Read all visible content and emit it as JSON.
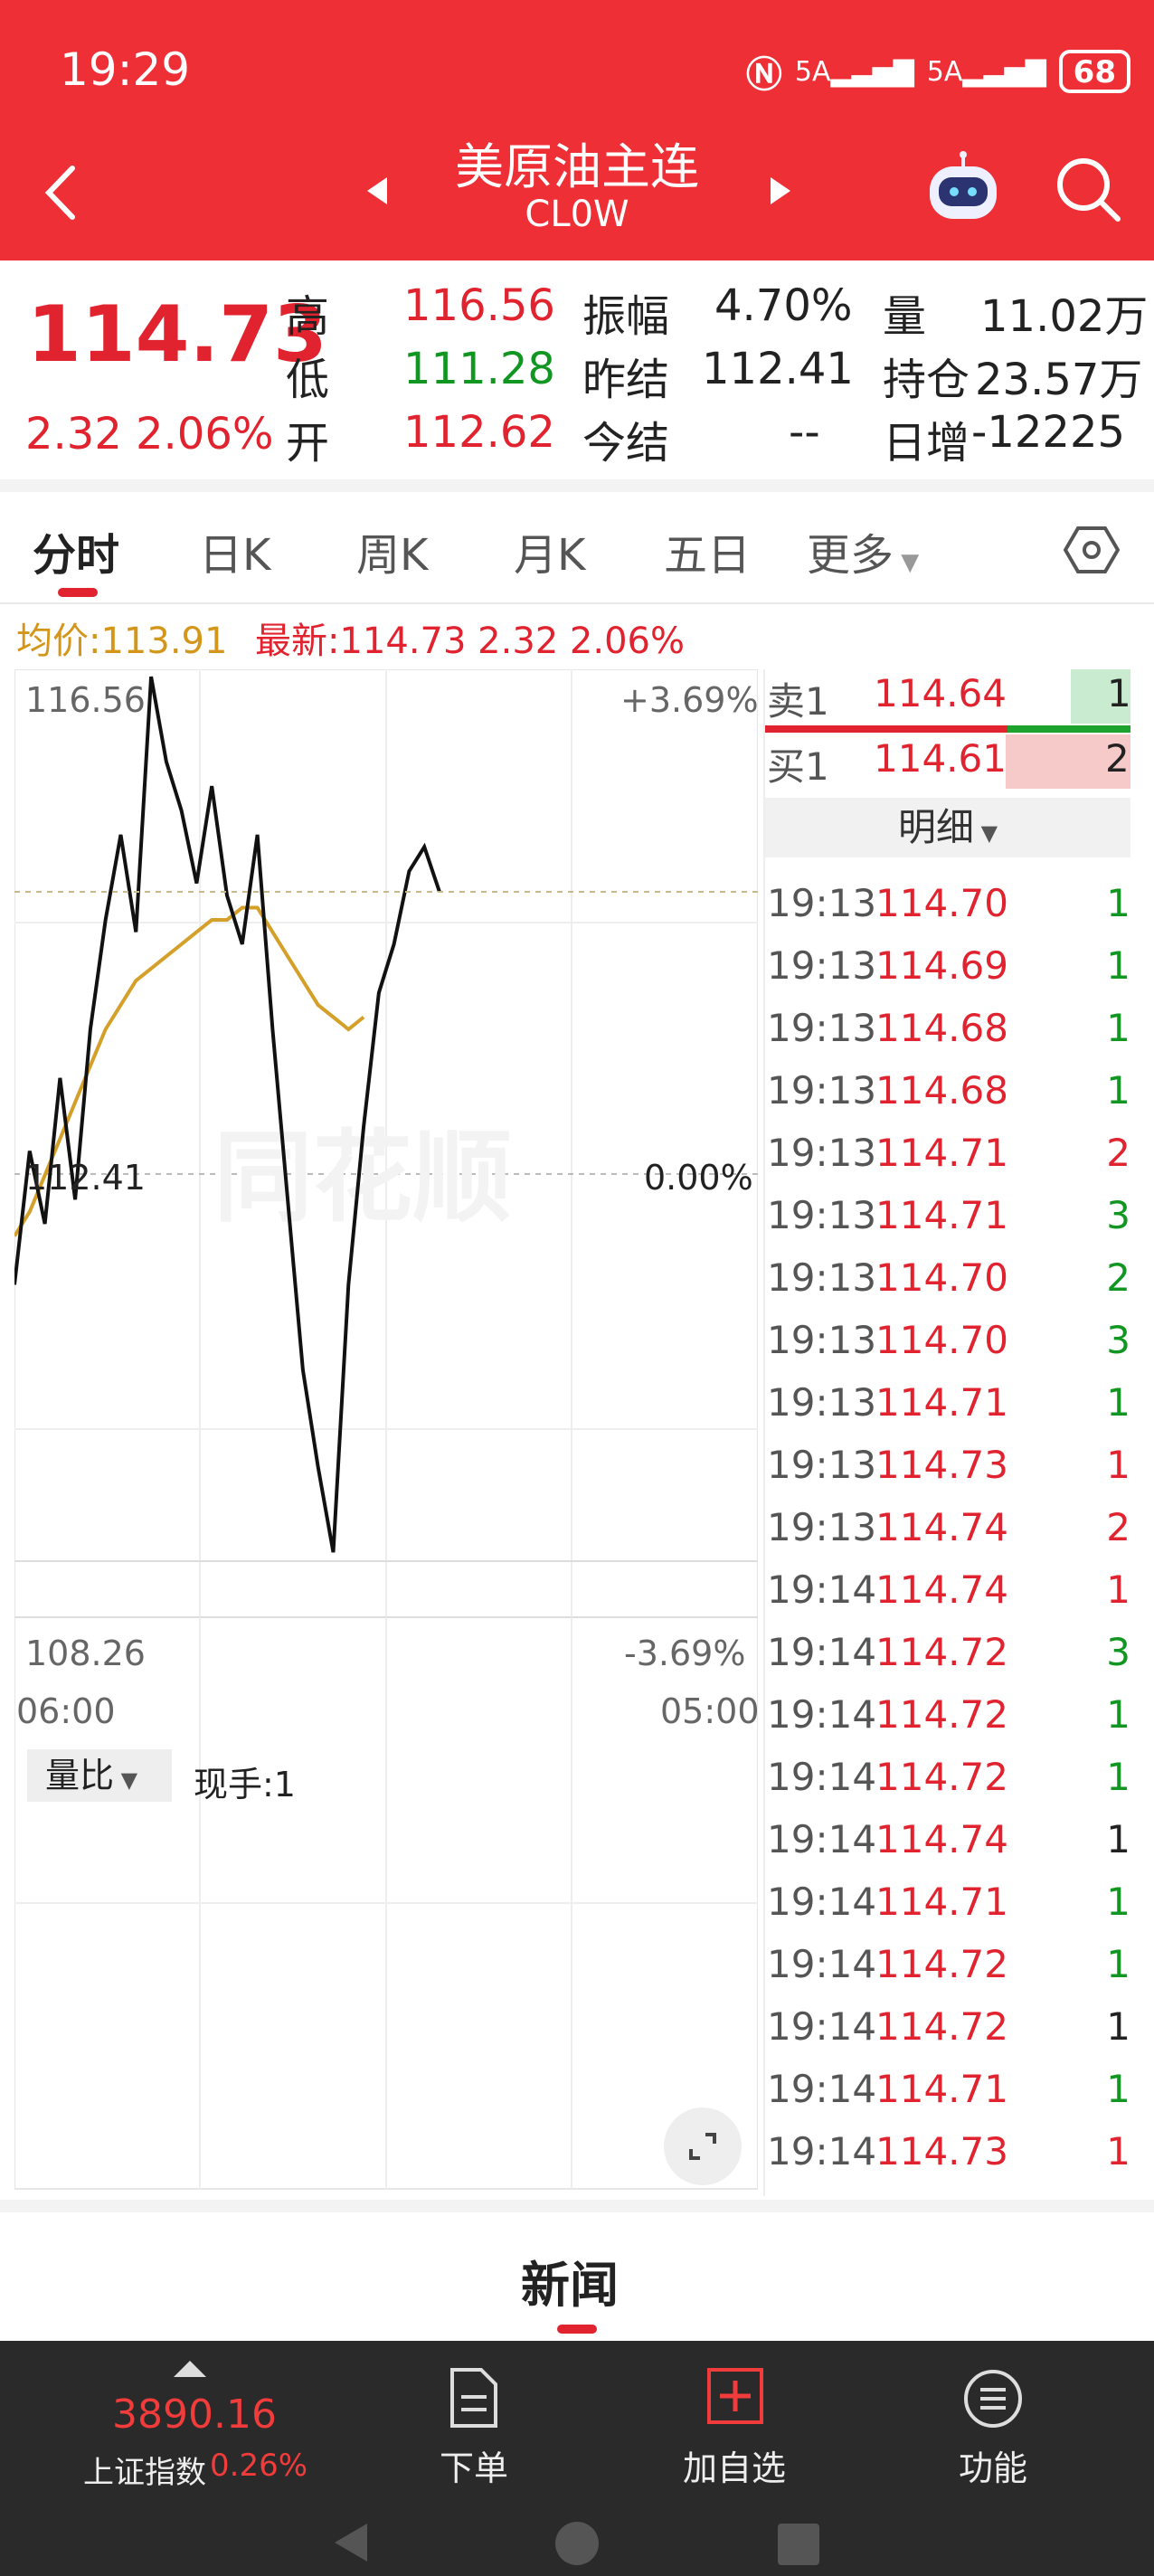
{
  "status": {
    "time": "19:29",
    "signal1": "5A",
    "signal2": "5A",
    "battery": "68"
  },
  "header": {
    "title": "美原油主连",
    "code": "CL0W"
  },
  "quote": {
    "price": "114.73",
    "change": "2.32",
    "change_pct": "2.06%",
    "high_label": "高",
    "high": "116.56",
    "low_label": "低",
    "low": "111.28",
    "open_label": "开",
    "open": "112.62",
    "amp_label": "振幅",
    "amp": "4.70%",
    "prev_label": "昨结",
    "prev": "112.41",
    "settle_label": "今结",
    "settle": "--",
    "vol_label": "量",
    "vol": "11.02万",
    "oi_label": "持仓",
    "oi": "23.57万",
    "daily_label": "日增",
    "daily": "-12225"
  },
  "tabs": [
    "分时",
    "日K",
    "周K",
    "月K",
    "五日",
    "更多"
  ],
  "legend": {
    "avg": "均价:113.91",
    "latest": "最新:114.73 2.32 2.06%"
  },
  "axis": {
    "top": "116.56",
    "top_pct": "+3.69%",
    "mid": "112.41",
    "mid_pct": "0.00%",
    "bottom": "108.26",
    "bottom_pct": "-3.69%",
    "start": "06:00",
    "end": "05:00"
  },
  "chart_data": {
    "type": "line",
    "ylim": [
      108.26,
      116.56
    ],
    "reference": 112.41,
    "series": [
      {
        "values": [
          111.5,
          112.6,
          112.0,
          113.2,
          112.2,
          113.6,
          114.5,
          115.2,
          114.4,
          116.5,
          115.8,
          115.4,
          114.8,
          115.6,
          114.7,
          114.3,
          115.2,
          113.6,
          112.2,
          110.8,
          110.0,
          109.3,
          111.5,
          112.8,
          113.9,
          114.3,
          114.9,
          115.1,
          114.73
        ]
      },
      {
        "values": [
          111.9,
          112.1,
          112.4,
          112.7,
          113.0,
          113.3,
          113.6,
          113.8,
          114.0,
          114.1,
          114.2,
          114.3,
          114.4,
          114.5,
          114.5,
          114.6,
          114.6,
          114.4,
          114.2,
          114.0,
          113.8,
          113.7,
          113.6,
          113.7
        ]
      }
    ]
  },
  "volume": {
    "label": "量比",
    "current": "现手:1"
  },
  "orderbook": {
    "sell_label": "卖1",
    "sell_price": "114.64",
    "sell_vol": "1",
    "buy_label": "买1",
    "buy_price": "114.61",
    "buy_vol": "2",
    "detail": "明细"
  },
  "trades": [
    {
      "t": "19:13",
      "p": "114.70",
      "v": "1",
      "c": "#119622"
    },
    {
      "t": "19:13",
      "p": "114.69",
      "v": "1",
      "c": "#119622"
    },
    {
      "t": "19:13",
      "p": "114.68",
      "v": "1",
      "c": "#119622"
    },
    {
      "t": "19:13",
      "p": "114.68",
      "v": "1",
      "c": "#119622"
    },
    {
      "t": "19:13",
      "p": "114.71",
      "v": "2",
      "c": "#e0232f"
    },
    {
      "t": "19:13",
      "p": "114.71",
      "v": "3",
      "c": "#119622"
    },
    {
      "t": "19:13",
      "p": "114.70",
      "v": "2",
      "c": "#119622"
    },
    {
      "t": "19:13",
      "p": "114.70",
      "v": "3",
      "c": "#119622"
    },
    {
      "t": "19:13",
      "p": "114.71",
      "v": "1",
      "c": "#119622"
    },
    {
      "t": "19:13",
      "p": "114.73",
      "v": "1",
      "c": "#e0232f"
    },
    {
      "t": "19:13",
      "p": "114.74",
      "v": "2",
      "c": "#e0232f"
    },
    {
      "t": "19:14",
      "p": "114.74",
      "v": "1",
      "c": "#e0232f"
    },
    {
      "t": "19:14",
      "p": "114.72",
      "v": "3",
      "c": "#119622"
    },
    {
      "t": "19:14",
      "p": "114.72",
      "v": "1",
      "c": "#119622"
    },
    {
      "t": "19:14",
      "p": "114.72",
      "v": "1",
      "c": "#119622"
    },
    {
      "t": "19:14",
      "p": "114.74",
      "v": "1",
      "c": "#222222"
    },
    {
      "t": "19:14",
      "p": "114.71",
      "v": "1",
      "c": "#119622"
    },
    {
      "t": "19:14",
      "p": "114.72",
      "v": "1",
      "c": "#119622"
    },
    {
      "t": "19:14",
      "p": "114.72",
      "v": "1",
      "c": "#222222"
    },
    {
      "t": "19:14",
      "p": "114.71",
      "v": "1",
      "c": "#119622"
    },
    {
      "t": "19:14",
      "p": "114.73",
      "v": "1",
      "c": "#e0232f"
    }
  ],
  "news": {
    "label": "新闻"
  },
  "bottom": {
    "index_value": "3890.16",
    "index_name": "上证指数",
    "index_pct": "0.26%",
    "order": "下单",
    "add": "加自选",
    "func": "功能"
  }
}
